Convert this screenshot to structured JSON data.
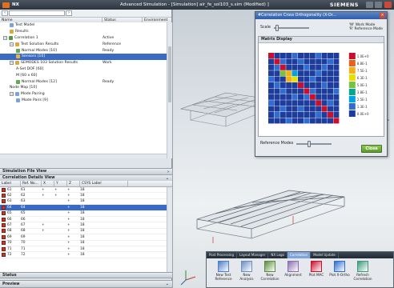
{
  "titlebar": {
    "app_name": "NX",
    "window_title": "Advanced Simulation - [Simulation] air_fe_sol103_s.sim (Modified) ]",
    "brand": "SIEMENS"
  },
  "navigator": {
    "columns": [
      "Name",
      "Status",
      "Environment"
    ],
    "tree": [
      {
        "label": "Test Model",
        "status": "",
        "indent": 1,
        "expander": "",
        "icon": "#7aa3d8",
        "selected": false
      },
      {
        "label": "Results",
        "status": "",
        "indent": 1,
        "expander": "",
        "icon": "#d9a93c",
        "selected": false
      },
      {
        "label": "Correlation 1",
        "status": "Active",
        "indent": 0,
        "expander": "−",
        "icon": "#55963a",
        "selected": false
      },
      {
        "label": "Test Solution Results",
        "status": "Reference",
        "indent": 1,
        "expander": "−",
        "icon": "#d9a93c",
        "selected": false
      },
      {
        "label": "Normal Modes [10]",
        "status": "Ready",
        "indent": 2,
        "expander": "",
        "icon": "#6aa84f",
        "selected": false
      },
      {
        "label": "Sensors [10]",
        "status": "",
        "indent": 2,
        "expander": "",
        "icon": "#e0b64a",
        "selected": true
      },
      {
        "label": "SEMODES 103 Solution Results",
        "status": "Work",
        "indent": 1,
        "expander": "−",
        "icon": "#d9a93c",
        "selected": false
      },
      {
        "label": "A-Set DOF [60]",
        "status": "",
        "indent": 2,
        "expander": "",
        "icon": "",
        "selected": false
      },
      {
        "label": "M [60 x 60]",
        "status": "",
        "indent": 2,
        "expander": "",
        "icon": "",
        "selected": false
      },
      {
        "label": "Normal Modes [12]",
        "status": "Ready",
        "indent": 2,
        "expander": "",
        "icon": "#6aa84f",
        "selected": false
      },
      {
        "label": "Node Map [10]",
        "status": "",
        "indent": 1,
        "expander": "",
        "icon": "",
        "selected": false
      },
      {
        "label": "Mode Pairing",
        "status": "",
        "indent": 1,
        "expander": "−",
        "icon": "#7aa3d8",
        "selected": false
      },
      {
        "label": "Mode Pairs [9]",
        "status": "",
        "indent": 2,
        "expander": "",
        "icon": "#7aa3d8",
        "selected": false
      }
    ]
  },
  "sections": {
    "file_view": "Simulation File View",
    "correlation_details": "Correlation Details View",
    "status": "Status",
    "preview": "Preview"
  },
  "correlation_table": {
    "columns": [
      "Label",
      "Ref. No...",
      "X",
      "Y",
      "Z",
      "CSYS Label"
    ],
    "rows": [
      {
        "label": "61",
        "ref": "61",
        "x": "+",
        "y": "+",
        "z": "+",
        "csys": "18",
        "selected": false
      },
      {
        "label": "62",
        "ref": "62",
        "x": "+",
        "y": "+",
        "z": "+",
        "csys": "18",
        "selected": false
      },
      {
        "label": "63",
        "ref": "63",
        "x": "",
        "y": "",
        "z": "+",
        "csys": "18",
        "selected": false
      },
      {
        "label": "64",
        "ref": "64",
        "x": "",
        "y": "",
        "z": "+",
        "csys": "18",
        "selected": true
      },
      {
        "label": "65",
        "ref": "65",
        "x": "",
        "y": "",
        "z": "+",
        "csys": "18",
        "selected": false
      },
      {
        "label": "66",
        "ref": "66",
        "x": "",
        "y": "",
        "z": "+",
        "csys": "18",
        "selected": false
      },
      {
        "label": "67",
        "ref": "67",
        "x": "+",
        "y": "",
        "z": "+",
        "csys": "18",
        "selected": false
      },
      {
        "label": "68",
        "ref": "68",
        "x": "+",
        "y": "",
        "z": "+",
        "csys": "18",
        "selected": false
      },
      {
        "label": "69",
        "ref": "69",
        "x": "",
        "y": "",
        "z": "+",
        "csys": "18",
        "selected": false
      },
      {
        "label": "70",
        "ref": "70",
        "x": "",
        "y": "",
        "z": "+",
        "csys": "18",
        "selected": false
      },
      {
        "label": "71",
        "ref": "71",
        "x": "",
        "y": "",
        "z": "+",
        "csys": "18",
        "selected": false
      },
      {
        "label": "72",
        "ref": "72",
        "x": "",
        "y": "",
        "z": "+",
        "csys": "18",
        "selected": false
      }
    ]
  },
  "dialog": {
    "title": "#Correlation Cross Orthogonality (X-Or...",
    "scale_label": "Scale",
    "legend_note": [
      "'W' Work Mode",
      "'R' Reference Mode"
    ],
    "matrix_title": "Matrix Display",
    "reference_modes_label": "Reference Modes",
    "close_label": "Close",
    "matrix_values": [
      [
        1.0,
        0.0,
        0.0,
        0.0,
        0.1,
        0.0,
        0.0,
        0.0,
        0.1,
        0.0,
        0.0,
        0.0
      ],
      [
        0.0,
        1.0,
        0.1,
        0.0,
        0.0,
        0.1,
        0.0,
        0.0,
        0.0,
        0.0,
        0.1,
        0.0
      ],
      [
        0.0,
        0.1,
        1.0,
        0.0,
        0.0,
        0.0,
        0.1,
        0.0,
        0.0,
        0.1,
        0.0,
        0.0
      ],
      [
        0.0,
        0.0,
        0.5,
        0.7,
        0.2,
        0.0,
        0.0,
        0.0,
        0.1,
        0.0,
        0.0,
        0.0
      ],
      [
        0.1,
        0.0,
        0.0,
        0.8,
        0.6,
        0.0,
        0.0,
        0.1,
        0.0,
        0.0,
        0.0,
        0.0
      ],
      [
        0.0,
        0.1,
        0.0,
        0.0,
        0.0,
        1.0,
        0.0,
        0.0,
        0.0,
        0.1,
        0.0,
        0.0
      ],
      [
        0.0,
        0.0,
        0.1,
        0.0,
        0.0,
        0.0,
        1.0,
        0.1,
        0.0,
        0.0,
        0.0,
        0.1
      ],
      [
        0.0,
        0.0,
        0.0,
        0.0,
        0.1,
        0.0,
        0.1,
        1.0,
        0.0,
        0.0,
        0.0,
        0.0
      ],
      [
        0.1,
        0.0,
        0.0,
        0.0,
        0.0,
        0.0,
        0.0,
        0.0,
        1.0,
        0.0,
        0.1,
        0.0
      ],
      [
        0.0,
        0.0,
        0.1,
        0.0,
        0.0,
        0.1,
        0.0,
        0.0,
        0.0,
        1.0,
        0.0,
        0.0
      ],
      [
        0.0,
        0.1,
        0.0,
        0.0,
        0.0,
        0.0,
        0.0,
        0.0,
        0.1,
        0.0,
        1.0,
        0.0
      ],
      [
        0.0,
        0.0,
        0.0,
        0.1,
        0.0,
        0.0,
        0.1,
        0.0,
        0.0,
        0.0,
        0.0,
        1.0
      ]
    ],
    "legend_colors": [
      "#c8102e",
      "#e8601c",
      "#f2b01e",
      "#e8e000",
      "#7ac143",
      "#00a88f",
      "#00a3e0",
      "#2f6ed0",
      "#1d3c9c"
    ],
    "legend_labels": [
      "1.0E+0",
      "8.8E-1",
      "7.5E-1",
      "6.3E-1",
      "5.0E-1",
      "3.8E-1",
      "2.5E-1",
      "1.3E-1",
      "0.0E+0"
    ]
  },
  "ribbon": {
    "tabs": [
      "Post Processing",
      "Layout Manager",
      "NX Logo",
      "Correlation",
      "Model Update"
    ],
    "active_tab": 3,
    "buttons": [
      {
        "label": "New Test Reference",
        "icon": "test-reference-icon",
        "color": "#4f7fc4"
      },
      {
        "label": "New Analysis",
        "icon": "analysis-icon",
        "color": "#6b8fc2"
      },
      {
        "label": "New Correlation",
        "icon": "correlation-icon",
        "color": "#5a8d3b"
      },
      {
        "label": "Alignment",
        "icon": "alignment-icon",
        "color": "#8a6fb0"
      },
      {
        "label": "Plot MAC",
        "icon": "plot-mac-icon",
        "color": "#c8102e"
      },
      {
        "label": "Plot X-Ortho",
        "icon": "plot-xortho-icon",
        "color": "#2f6ed0"
      },
      {
        "label": "Refresh Correlation",
        "icon": "refresh-icon",
        "color": "#3d9a7a"
      }
    ]
  },
  "colors": {
    "selection": "#3a6bc4",
    "mesh": "#6e7780"
  }
}
